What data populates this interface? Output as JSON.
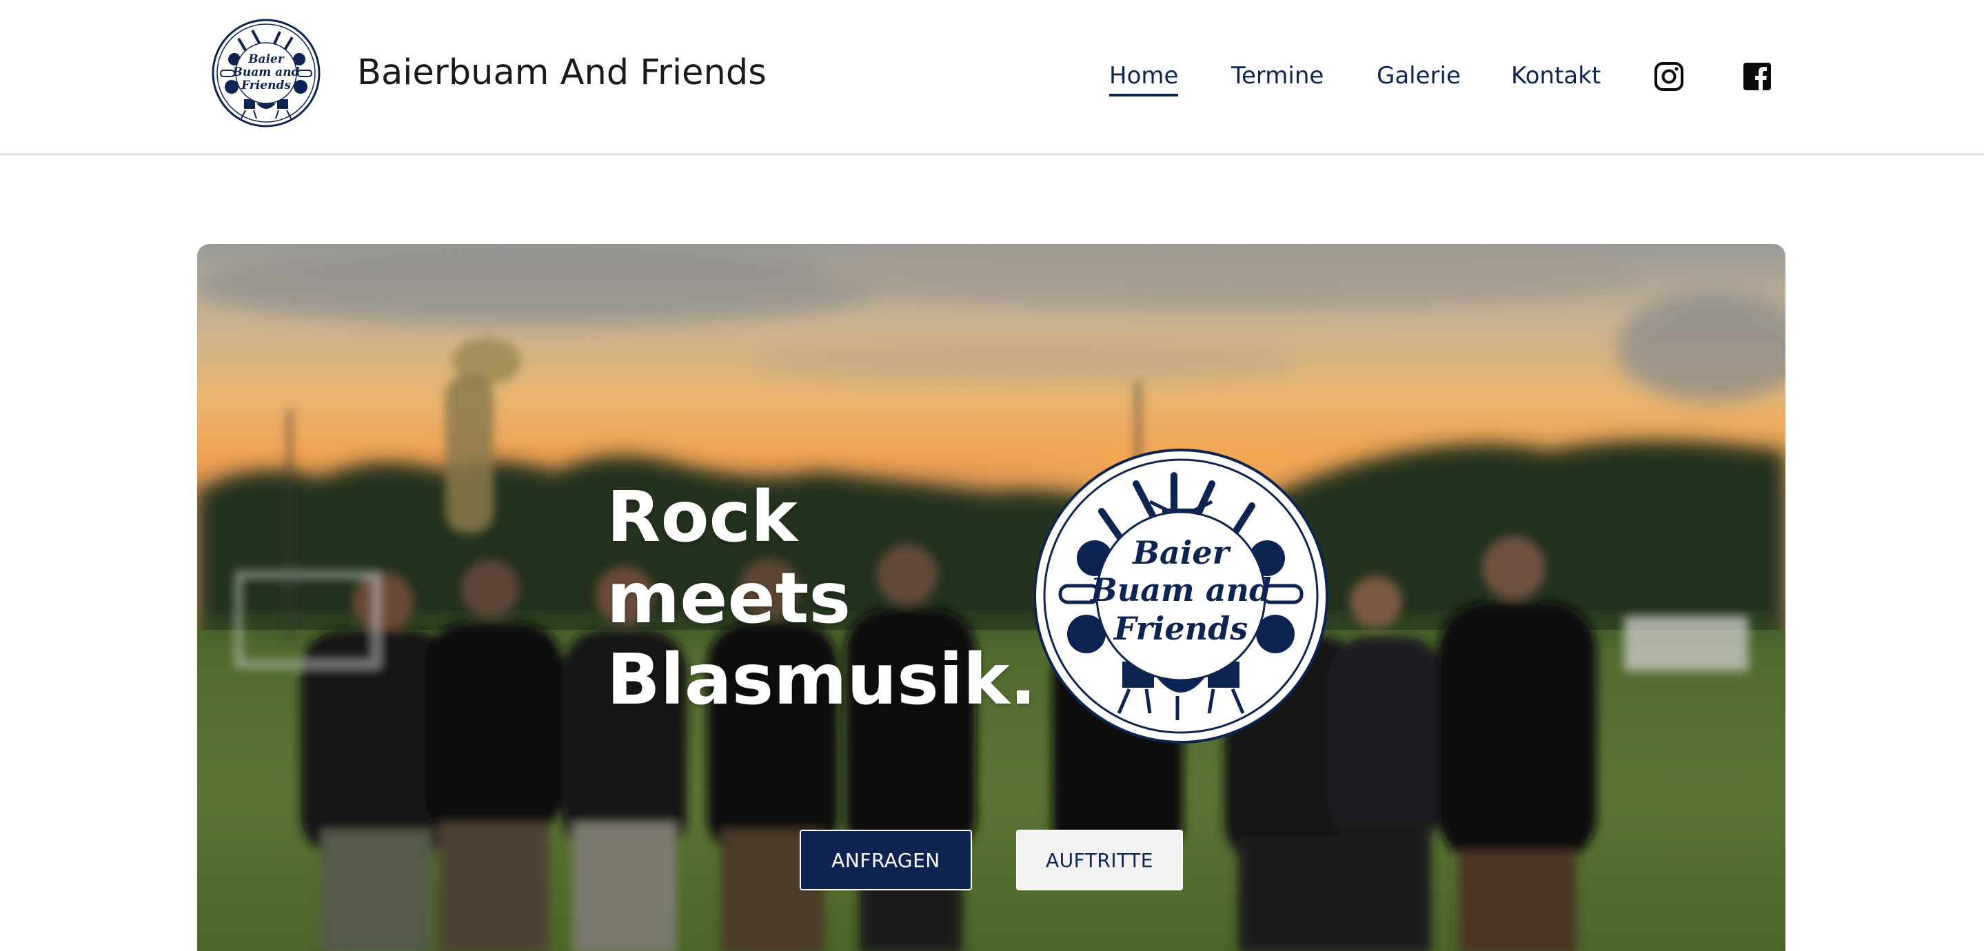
{
  "header": {
    "logo_text": [
      "Baier",
      "Buam and",
      "Friends"
    ],
    "title": "Baierbuam And Friends",
    "nav": {
      "home": "Home",
      "termine": "Termine",
      "galerie": "Galerie",
      "kontakt": "Kontakt"
    },
    "social": [
      "instagram-icon",
      "facebook-icon"
    ]
  },
  "hero": {
    "headline": [
      "Rock",
      "meets",
      "Blasmusik."
    ],
    "badge_text": [
      "Baier",
      "Buam and",
      "Friends"
    ],
    "buttons": {
      "primary": "ANFRAGEN",
      "secondary": "AUFTRITTE"
    }
  },
  "colors": {
    "brand_navy": "#0d2452",
    "header_text": "#1a1a1a",
    "divider": "#d9d9d9"
  }
}
